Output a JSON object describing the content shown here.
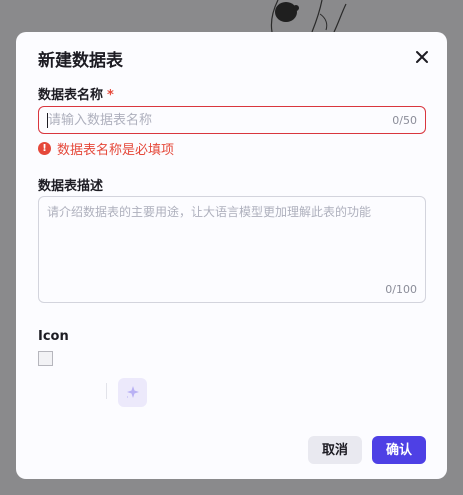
{
  "dialog": {
    "title": "新建数据表",
    "name_field": {
      "label": "数据表名称",
      "required_mark": "*",
      "placeholder": "请输入数据表名称",
      "value": "",
      "counter": "0/50",
      "error": "数据表名称是必填项"
    },
    "desc_field": {
      "label": "数据表描述",
      "placeholder": "请介绍数据表的主要用途，让大语言模型更加理解此表的功能",
      "value": "",
      "counter": "0/100"
    },
    "icon_section": {
      "label": "Icon"
    },
    "buttons": {
      "cancel": "取消",
      "confirm": "确认"
    }
  },
  "colors": {
    "accent": "#4e40e5",
    "error": "#e5483a",
    "overlay": "#8a8a8c",
    "ai_button_bg": "#ece9fb"
  },
  "icons": {
    "close": "close-icon",
    "error": "error-circle-icon",
    "ai": "sparkle-icon",
    "image": "broken-image-icon"
  }
}
